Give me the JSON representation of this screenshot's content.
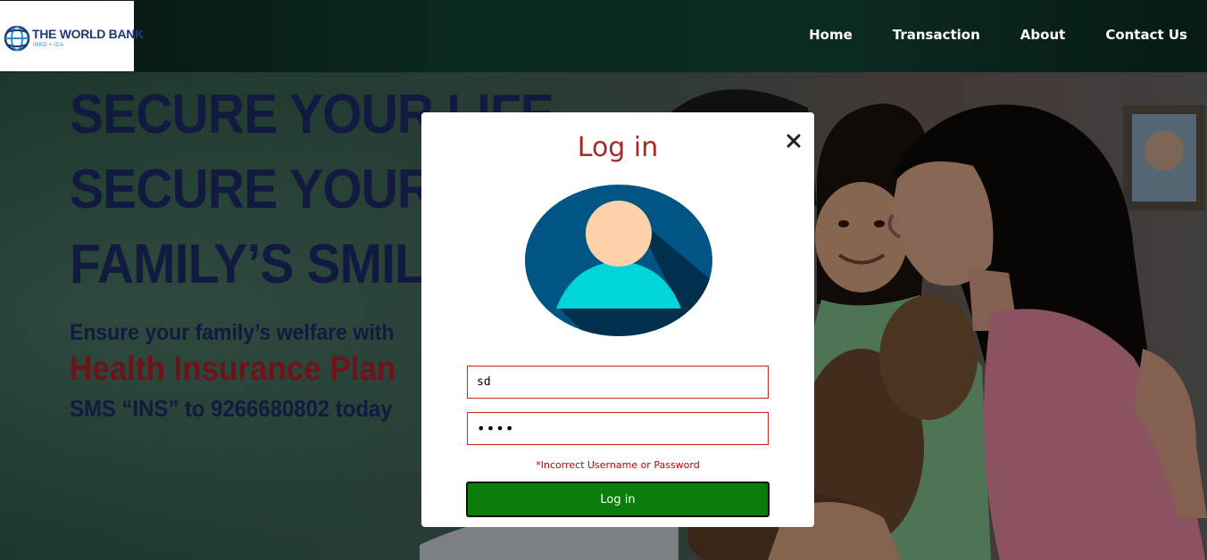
{
  "header": {
    "logo": {
      "title": "THE WORLD BANK",
      "subtitle": "IBRD • IDA",
      "icon": "globe-icon"
    },
    "nav": [
      {
        "label": "Home"
      },
      {
        "label": "Transaction"
      },
      {
        "label": "About"
      },
      {
        "label": "Contact Us"
      }
    ]
  },
  "hero": {
    "lines": [
      "SECURE YOUR LIFE",
      "SECURE YOUR",
      "FAMILY’S SMIL",
      "Ensure your family’s welfare with",
      "Health Insurance Plan",
      "SMS “INS” to 9266680802 today"
    ]
  },
  "modal": {
    "title": "Log in",
    "close_icon": "close-icon",
    "avatar_icon": "user-avatar-icon",
    "username_value": "sd",
    "password_value": "••••",
    "error_text": "*Incorrect Username or Password",
    "submit_label": "Log in"
  },
  "colors": {
    "title": "#a52a2a",
    "error": "#c00000",
    "field_border": "#d32020",
    "button_bg": "#0a7d0a",
    "avatar_bg": "#005585",
    "avatar_shadow": "#00304d",
    "avatar_face": "#ffd1a8",
    "avatar_body": "#00d5d9"
  }
}
